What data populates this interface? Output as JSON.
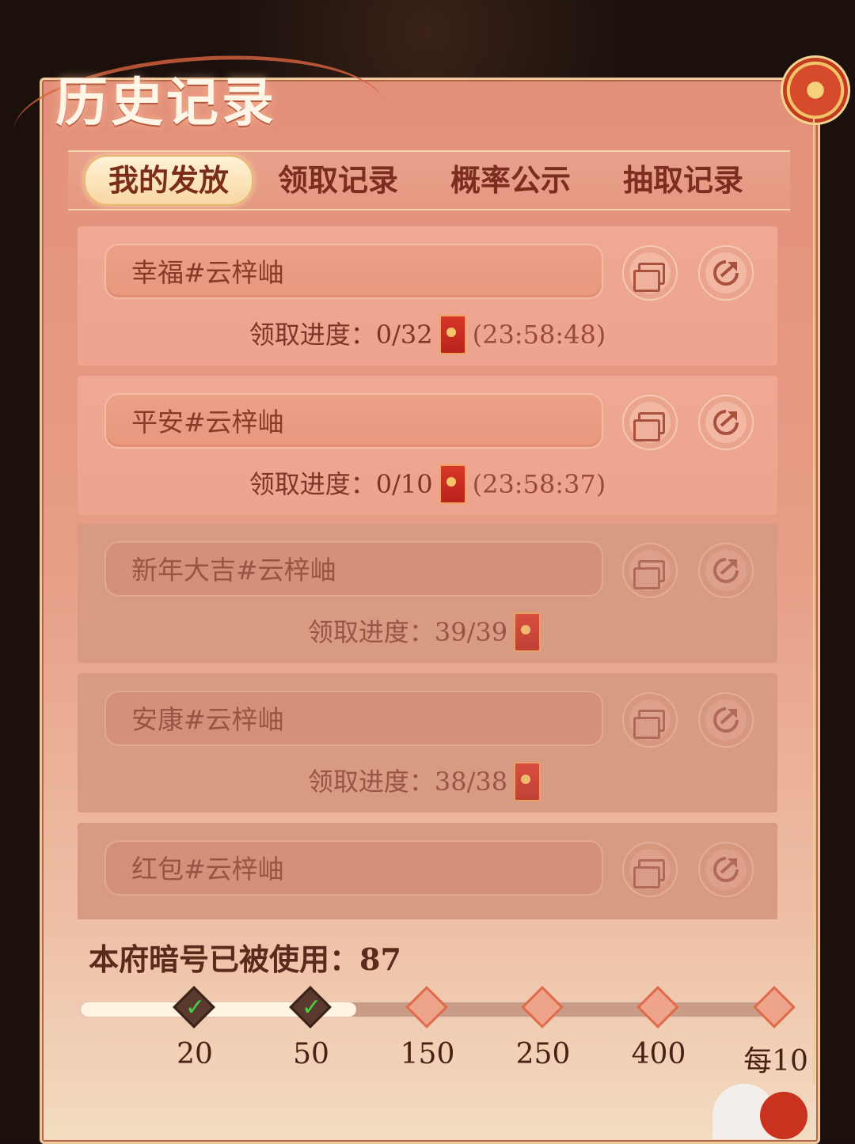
{
  "header": {
    "title": "历史记录"
  },
  "tabs": [
    {
      "label": "我的发放",
      "active": true
    },
    {
      "label": "领取记录",
      "active": false
    },
    {
      "label": "概率公示",
      "active": false
    },
    {
      "label": "抽取记录",
      "active": false
    }
  ],
  "records": [
    {
      "name": "幸福#云梓岫",
      "progress_label": "领取进度：",
      "progress": "0/32",
      "timer": "(23:58:48)",
      "completed": false
    },
    {
      "name": "平安#云梓岫",
      "progress_label": "领取进度：",
      "progress": "0/10",
      "timer": "(23:58:37)",
      "completed": false
    },
    {
      "name": "新年大吉#云梓岫",
      "progress_label": "领取进度：",
      "progress": "39/39",
      "timer": "",
      "completed": true
    },
    {
      "name": "安康#云梓岫",
      "progress_label": "领取进度：",
      "progress": "38/38",
      "timer": "",
      "completed": true
    },
    {
      "name": "红包#云梓岫",
      "progress_label": "",
      "progress": "",
      "timer": "",
      "completed": true
    }
  ],
  "usage": {
    "label": "本府暗号已被使用：87",
    "count": 87
  },
  "milestones": [
    {
      "label": "20",
      "reached": true
    },
    {
      "label": "50",
      "reached": true
    },
    {
      "label": "150",
      "reached": false
    },
    {
      "label": "250",
      "reached": false
    },
    {
      "label": "400",
      "reached": false
    },
    {
      "label": "每10",
      "reached": false
    }
  ],
  "track_fill_fraction": 0.395,
  "colors": {
    "accent": "#e3907a",
    "active_tab": "#fff2d6",
    "check": "#46d04a"
  },
  "icons": {
    "copy": "copy-icon",
    "share": "share-icon",
    "red_packet": "red-packet-icon",
    "check": "check-icon"
  }
}
